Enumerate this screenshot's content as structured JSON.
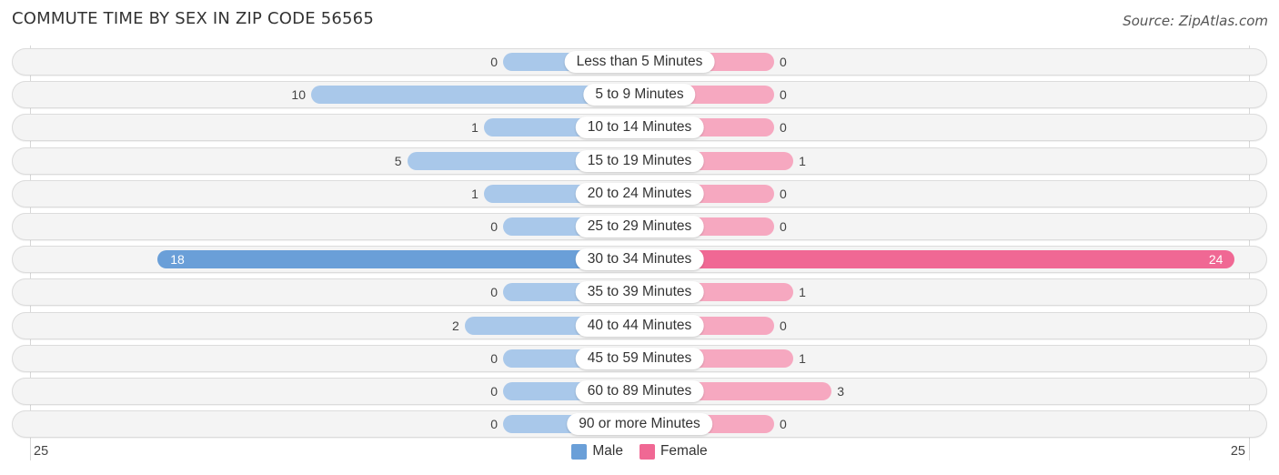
{
  "title": "COMMUTE TIME BY SEX IN ZIP CODE 56565",
  "source": "Source: ZipAtlas.com",
  "colors": {
    "male_light": "#a9c8ea",
    "male_strong": "#6a9fd8",
    "female_light": "#f6a8c0",
    "female_strong": "#f06894",
    "row_background": "#f4f4f4"
  },
  "legend": {
    "male_label": "Male",
    "female_label": "Female",
    "male_color": "#6a9fd8",
    "female_color": "#f06894"
  },
  "axis": {
    "left_label": "25",
    "right_label": "25"
  },
  "chart_data": {
    "type": "bar",
    "orientation": "horizontal-diverging",
    "title": "COMMUTE TIME BY SEX IN ZIP CODE 56565",
    "xlabel": "",
    "ylabel": "",
    "xlim": [
      -25,
      25
    ],
    "legend_position": "bottom-center",
    "grid": false,
    "categories": [
      "Less than 5 Minutes",
      "5 to 9 Minutes",
      "10 to 14 Minutes",
      "15 to 19 Minutes",
      "20 to 24 Minutes",
      "25 to 29 Minutes",
      "30 to 34 Minutes",
      "35 to 39 Minutes",
      "40 to 44 Minutes",
      "45 to 59 Minutes",
      "60 to 89 Minutes",
      "90 or more Minutes"
    ],
    "series": [
      {
        "name": "Male",
        "side": "left",
        "values": [
          0,
          10,
          1,
          5,
          1,
          0,
          18,
          0,
          2,
          0,
          0,
          0
        ]
      },
      {
        "name": "Female",
        "side": "right",
        "values": [
          0,
          0,
          0,
          1,
          0,
          0,
          24,
          1,
          0,
          1,
          3,
          0
        ]
      }
    ]
  }
}
